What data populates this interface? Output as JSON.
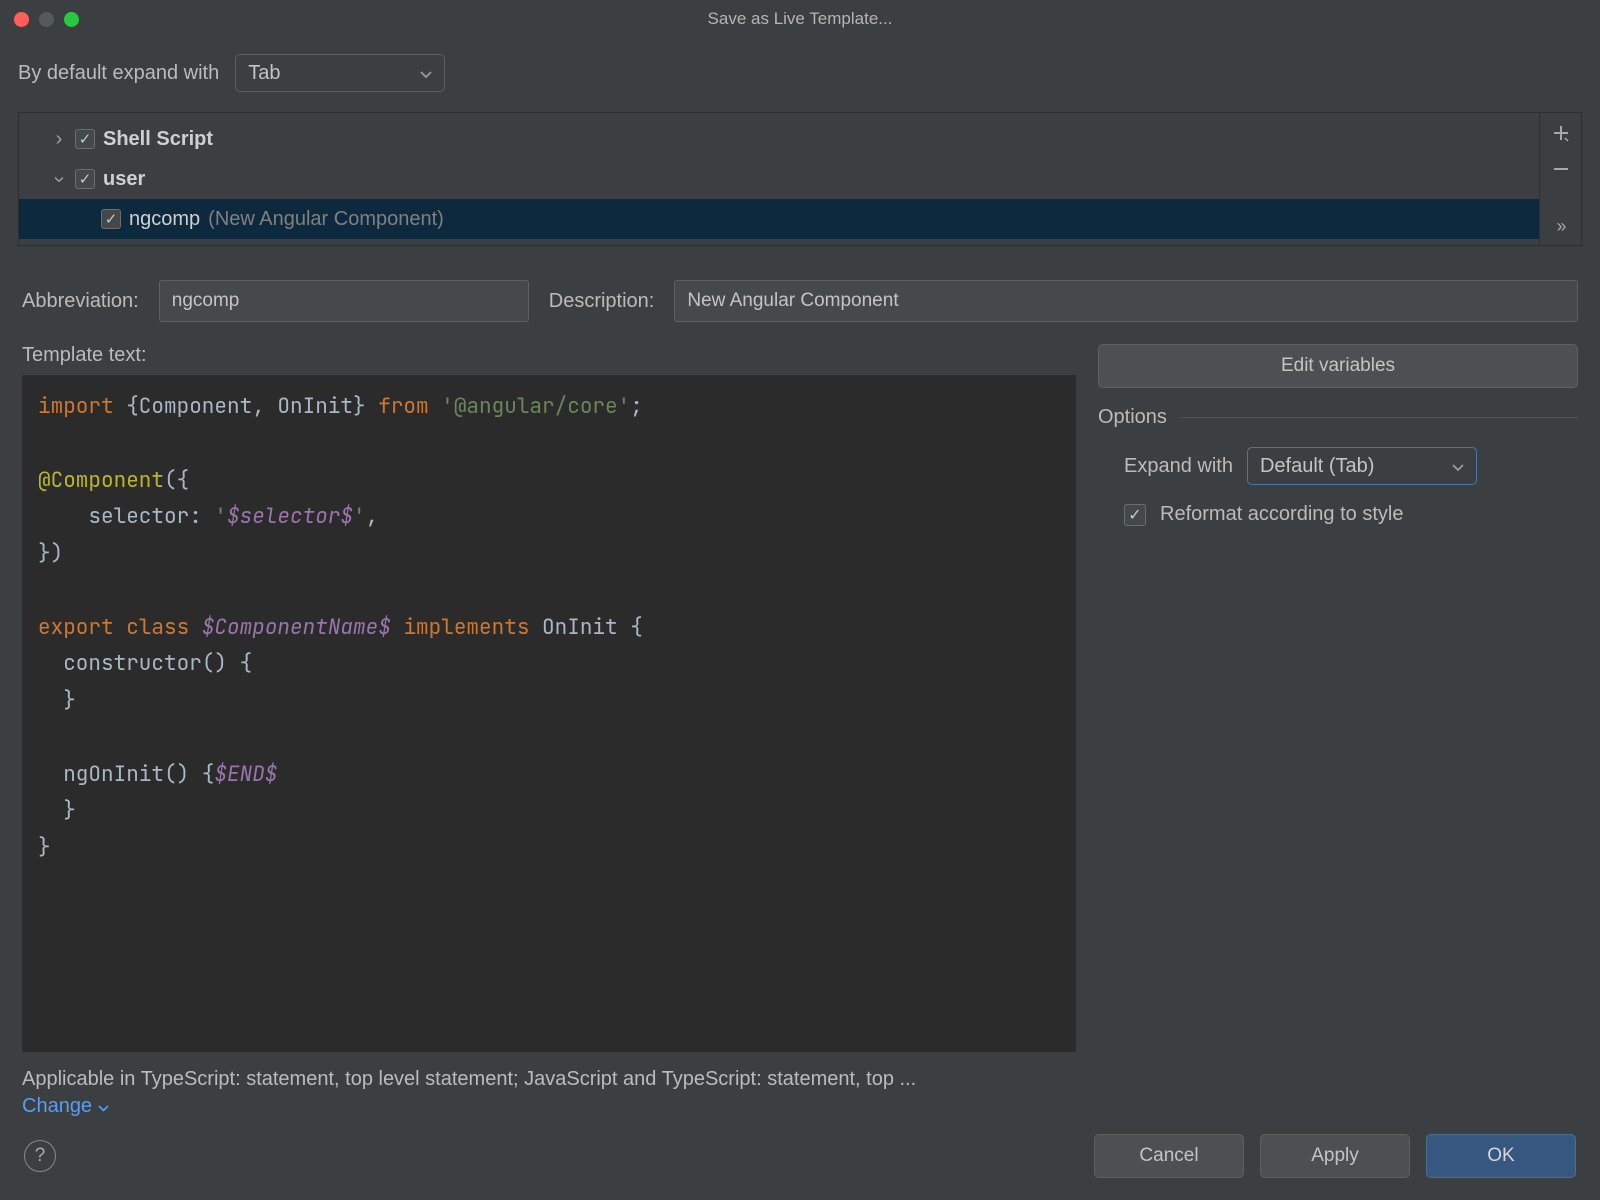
{
  "window": {
    "title": "Save as Live Template..."
  },
  "expand_default": {
    "label": "By default expand with",
    "value": "Tab"
  },
  "tree": {
    "groups": [
      {
        "expanded": false,
        "checked": true,
        "label": "Shell Script"
      },
      {
        "expanded": true,
        "checked": true,
        "label": "user"
      }
    ],
    "item": {
      "checked": true,
      "name": "ngcomp",
      "description": "(New Angular Component)"
    }
  },
  "abbreviation": {
    "label": "Abbreviation:",
    "value": "ngcomp"
  },
  "description": {
    "label": "Description:",
    "value": "New Angular Component"
  },
  "template_label": "Template text:",
  "code": {
    "l1a": "import",
    "l1b": " {Component, OnInit} ",
    "l1c": "from",
    "l1d": " ",
    "l1e": "'@angular/core'",
    "l1f": ";",
    "l3a": "@Component",
    "l3b": "({",
    "l4a": "    selector: ",
    "l4b": "'",
    "l4c": "$selector$",
    "l4d": "'",
    "l4e": ",",
    "l5": "})",
    "l7a": "export",
    "l7b": " ",
    "l7c": "class",
    "l7d": " ",
    "l7e": "$ComponentName$",
    "l7f": " ",
    "l7g": "implements",
    "l7h": " OnInit {",
    "l8": "  constructor() {",
    "l9": "  }",
    "l11a": "  ngOnInit() {",
    "l11b": "$END$",
    "l12": "  }",
    "l13": "}"
  },
  "applicable": "Applicable in TypeScript: statement, top level statement; JavaScript and TypeScript: statement, top ...",
  "change": "Change",
  "edit_vars": "Edit variables",
  "options": {
    "title": "Options",
    "expand_label": "Expand with",
    "expand_value": "Default (Tab)",
    "reformat": "Reformat according to style"
  },
  "buttons": {
    "cancel": "Cancel",
    "apply": "Apply",
    "ok": "OK"
  }
}
